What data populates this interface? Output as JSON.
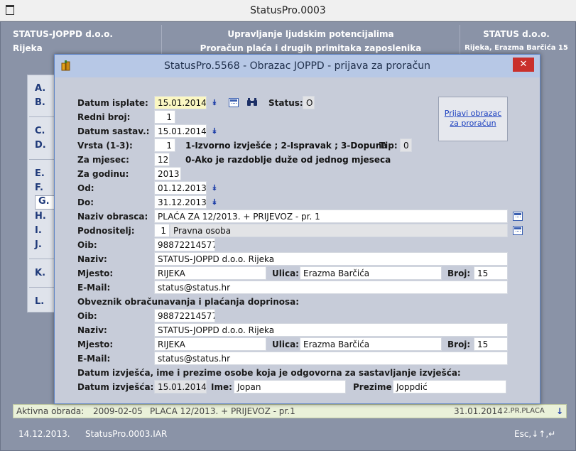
{
  "window": {
    "title": "StatusPro.0003"
  },
  "header": {
    "company": "STATUS-JOPPD d.o.o.",
    "city": "Rijeka",
    "line1": "Upravljanje ljudskim potencijalima",
    "line2": "Proračun plaća i drugih primitaka zaposlenika",
    "right_company": "STATUS d.o.o.",
    "right_address": "Rijeka, Erazma Barčića 15"
  },
  "menu": {
    "items": [
      "A.",
      "B.",
      "C.",
      "D.",
      "E.",
      "F.",
      "G.",
      "H.",
      "I.",
      "J.",
      "K.",
      "L."
    ]
  },
  "active_row": {
    "label": "Aktivna obrada:",
    "c1": "2009-02-05",
    "c2": "PLACA 12/2013. + PRIJEVOZ - pr.1",
    "c3": "31.01.2014",
    "c4": "2.PR.PLACA",
    "arrow": "↓"
  },
  "statusbar": {
    "date": "14.12.2013.",
    "program": "StatusPro.0003.IAR",
    "keys": "Esc,↓↑,↵"
  },
  "dialog": {
    "title": "StatusPro.5568 - Obrazac JOPPD - prijava za proračun",
    "close": "✕",
    "button_prijavi": "Prijavi obrazac za proračun",
    "datum_isplate": {
      "label": "Datum isplate:",
      "value": "15.01.2014"
    },
    "status": {
      "label": "Status:",
      "value": "O"
    },
    "redni_broj": {
      "label": "Redni broj:",
      "value": "1"
    },
    "datum_sastav": {
      "label": "Datum sastav.:",
      "value": "15.01.2014"
    },
    "vrsta": {
      "label": "Vrsta (1-3):",
      "value": "1",
      "note": "1-Izvorno izvješće ; 2-Ispravak ; 3-Dopuna"
    },
    "tip": {
      "label": "Tip:",
      "value": "0"
    },
    "za_mjesec": {
      "label": "Za mjesec:",
      "value": "12",
      "note": "0-Ako je razdoblje duže od jednog mjeseca"
    },
    "za_godinu": {
      "label": "Za godinu:",
      "value": "2013"
    },
    "od": {
      "label": "Od:",
      "value": "01.12.2013"
    },
    "do": {
      "label": "Do:",
      "value": "31.12.2013"
    },
    "naziv_obrasca": {
      "label": "Naziv obrasca:",
      "value": "PLAĆA ZA 12/2013. + PRIJEVOZ - pr. 1"
    },
    "podnositelj": {
      "label": "Podnositelj:",
      "code": "1",
      "value": "Pravna osoba"
    },
    "oib": {
      "label": "Oib:",
      "value": "98872214577"
    },
    "naziv": {
      "label": "Naziv:",
      "value": "STATUS-JOPPD d.o.o. Rijeka"
    },
    "mjesto": {
      "label": "Mjesto:",
      "value": "RIJEKA"
    },
    "ulica": {
      "label": "Ulica:",
      "value": "Erazma Barčića"
    },
    "broj": {
      "label": "Broj:",
      "value": "15"
    },
    "email": {
      "label": "E-Mail:",
      "value": "status@status.hr"
    },
    "obveznik_title": "Obveznik obračunavanja i plaćanja doprinosa:",
    "obv_oib": {
      "label": "Oib:",
      "value": "98872214577"
    },
    "obv_naziv": {
      "label": "Naziv:",
      "value": "STATUS-JOPPD d.o.o. Rijeka"
    },
    "obv_mjesto": {
      "label": "Mjesto:",
      "value": "RIJEKA"
    },
    "obv_ulica": {
      "label": "Ulica:",
      "value": "Erazma Barčića"
    },
    "obv_broj": {
      "label": "Broj:",
      "value": "15"
    },
    "obv_email": {
      "label": "E-Mail:",
      "value": "status@status.hr"
    },
    "izvjesce_title": "Datum izvješća, ime i prezime osobe koja je odgovorna za sastavljanje izvješća:",
    "datum_izvjesca": {
      "label": "Datum izvješća:",
      "value": "15.01.2014"
    },
    "ime": {
      "label": "Ime:",
      "value": "Jopan"
    },
    "prezime": {
      "label": "Prezime:",
      "value": "Joppdić"
    }
  }
}
